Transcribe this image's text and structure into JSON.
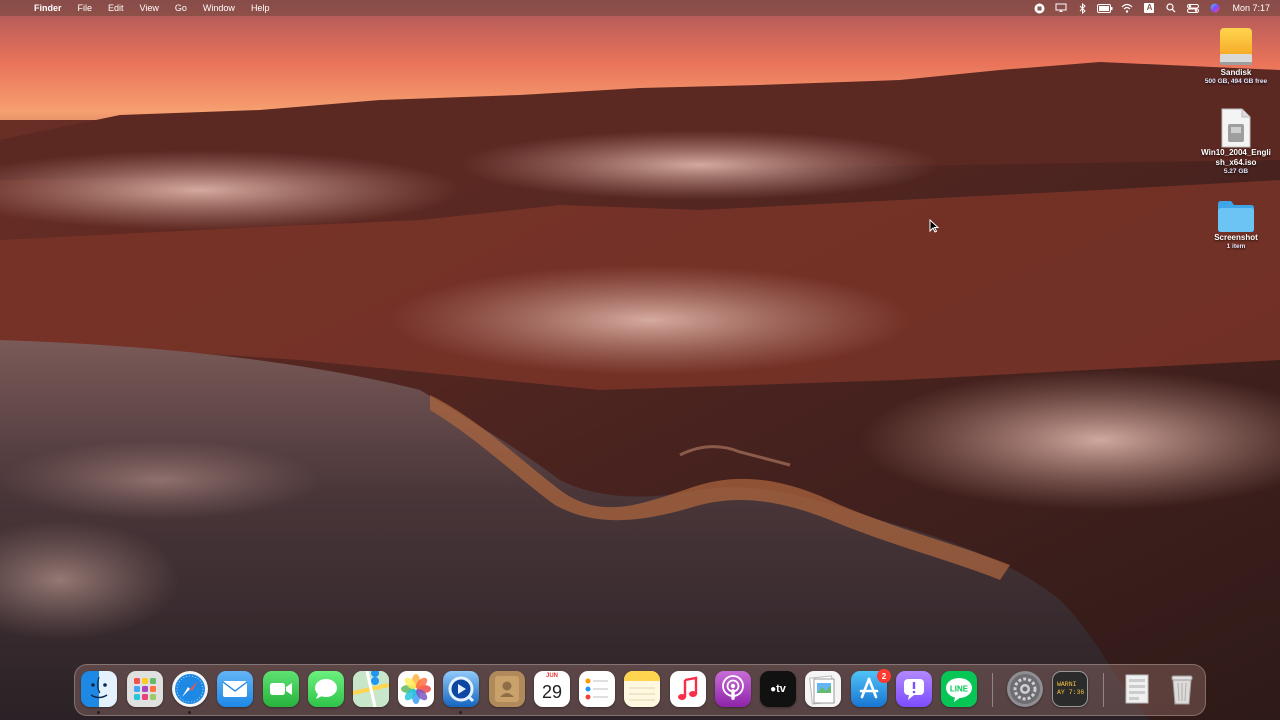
{
  "menubar": {
    "app_name": "Finder",
    "menus": [
      "File",
      "Edit",
      "View",
      "Go",
      "Window",
      "Help"
    ],
    "clock": "Mon 7:17",
    "keyboard_input": "A"
  },
  "desktop": {
    "items": [
      {
        "label": "Sandisk",
        "sub": "500 GB, 494 GB free",
        "icon": "external-drive-icon"
      },
      {
        "label_line1": "Win10_2004_Engli",
        "label_line2": "sh_x64.iso",
        "sub": "5.27 GB",
        "icon": "disk-image-icon"
      },
      {
        "label": "Screenshot",
        "sub": "1 item",
        "icon": "folder-icon"
      }
    ]
  },
  "dock": {
    "apps": [
      {
        "name": "Finder",
        "icon": "finder-icon",
        "running": true
      },
      {
        "name": "Launchpad",
        "icon": "launchpad-icon",
        "running": false
      },
      {
        "name": "Safari",
        "icon": "safari-icon",
        "running": true
      },
      {
        "name": "Mail",
        "icon": "mail-icon",
        "running": false
      },
      {
        "name": "FaceTime",
        "icon": "facetime-icon",
        "running": false
      },
      {
        "name": "Messages",
        "icon": "messages-icon",
        "running": false
      },
      {
        "name": "Maps",
        "icon": "maps-icon",
        "running": false
      },
      {
        "name": "Photos",
        "icon": "photos-icon",
        "running": false
      },
      {
        "name": "QuickTime Player",
        "icon": "quicktime-icon",
        "running": true
      },
      {
        "name": "Contacts",
        "icon": "contacts-icon",
        "running": false
      },
      {
        "name": "Calendar",
        "icon": "calendar-icon",
        "running": false
      },
      {
        "name": "Reminders",
        "icon": "reminders-icon",
        "running": false
      },
      {
        "name": "Notes",
        "icon": "notes-icon",
        "running": false
      },
      {
        "name": "Music",
        "icon": "music-icon",
        "running": false
      },
      {
        "name": "Podcasts",
        "icon": "podcasts-icon",
        "running": false
      },
      {
        "name": "TV",
        "icon": "tv-icon",
        "running": false
      },
      {
        "name": "Preview",
        "icon": "preview-icon",
        "running": false
      },
      {
        "name": "App Store",
        "icon": "app-store-icon",
        "running": false
      },
      {
        "name": "Feedback Assistant",
        "icon": "feedback-icon",
        "running": false
      },
      {
        "name": "LINE",
        "icon": "line-icon",
        "running": false
      },
      {
        "name": "System Preferences",
        "icon": "system-preferences-icon",
        "running": false
      },
      {
        "name": "Console",
        "icon": "console-icon",
        "running": false
      },
      {
        "name": "Downloads stack",
        "icon": "downloads-stack-icon",
        "running": false
      },
      {
        "name": "Trash",
        "icon": "trash-icon",
        "running": false
      }
    ],
    "calendar": {
      "month": "JUN",
      "day": "29"
    },
    "app_store_badge": "2",
    "tv_label": "tv",
    "line_label": "LINE",
    "console_text_line1": "WARNI",
    "console_text_line2": "AY 7:36"
  },
  "colors": {
    "sky_top": "#c76a5e",
    "sky_glow": "#ff9a6a",
    "mountain": "#5a2a22",
    "water": "#3a2a2e"
  }
}
